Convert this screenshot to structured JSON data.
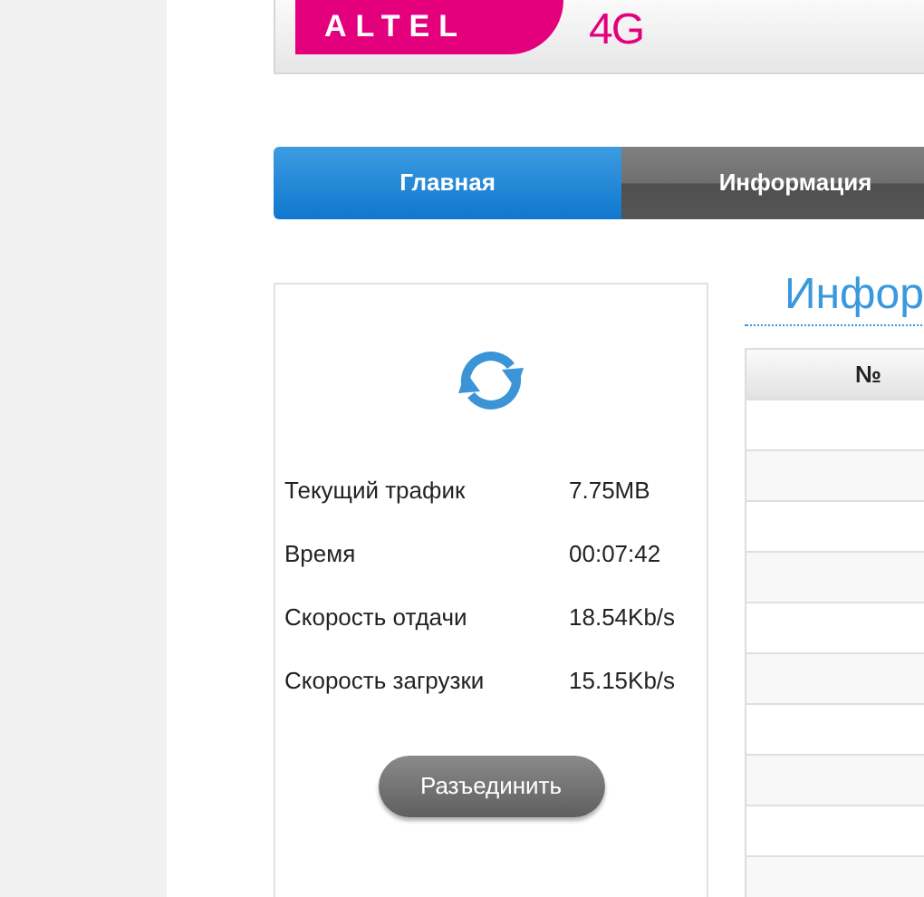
{
  "header": {
    "logo_text": "ALTEL",
    "logo_suffix": "4G"
  },
  "tabs": [
    {
      "label": "Главная",
      "selected": true
    },
    {
      "label": "Информация",
      "selected": false
    }
  ],
  "status_panel": {
    "rows": [
      {
        "label": "Текущий трафик",
        "value": "7.75MB"
      },
      {
        "label": "Время",
        "value": "00:07:42"
      },
      {
        "label": "Скорость отдачи",
        "value": "18.54Kb/s"
      },
      {
        "label": "Скорость загрузки",
        "value": "15.15Kb/s"
      }
    ],
    "button": "Разъединить"
  },
  "info": {
    "title": "Инфор",
    "table": {
      "columns": [
        "№"
      ]
    }
  }
}
